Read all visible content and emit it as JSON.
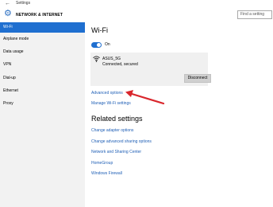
{
  "window": {
    "title": "Settings",
    "back_icon": "back-arrow-icon"
  },
  "header": {
    "title": "NETWORK & INTERNET",
    "search_placeholder": "Find a setting"
  },
  "sidebar": {
    "items": [
      {
        "label": "Wi-Fi",
        "active": true
      },
      {
        "label": "Airplane mode",
        "active": false
      },
      {
        "label": "Data usage",
        "active": false
      },
      {
        "label": "VPN",
        "active": false
      },
      {
        "label": "Dial-up",
        "active": false
      },
      {
        "label": "Ethernet",
        "active": false
      },
      {
        "label": "Proxy",
        "active": false
      }
    ]
  },
  "main": {
    "title": "Wi-Fi",
    "toggle": {
      "label": "On",
      "state": "on"
    },
    "network": {
      "name": "ASUS_5G",
      "status": "Connected, secured",
      "disconnect_label": "Disconnect"
    },
    "links": {
      "advanced_options": "Advanced options",
      "manage_wifi": "Manage Wi-Fi settings"
    },
    "related": {
      "title": "Related settings",
      "links": [
        "Change adapter options",
        "Change advanced sharing options",
        "Network and Sharing Center",
        "HomeGroup",
        "Windows Firewall"
      ]
    }
  },
  "colors": {
    "accent": "#1f6fd0",
    "link": "#1f5fb6",
    "arrow": "#d9262c",
    "sidebar_bg": "#f2f2f2"
  }
}
